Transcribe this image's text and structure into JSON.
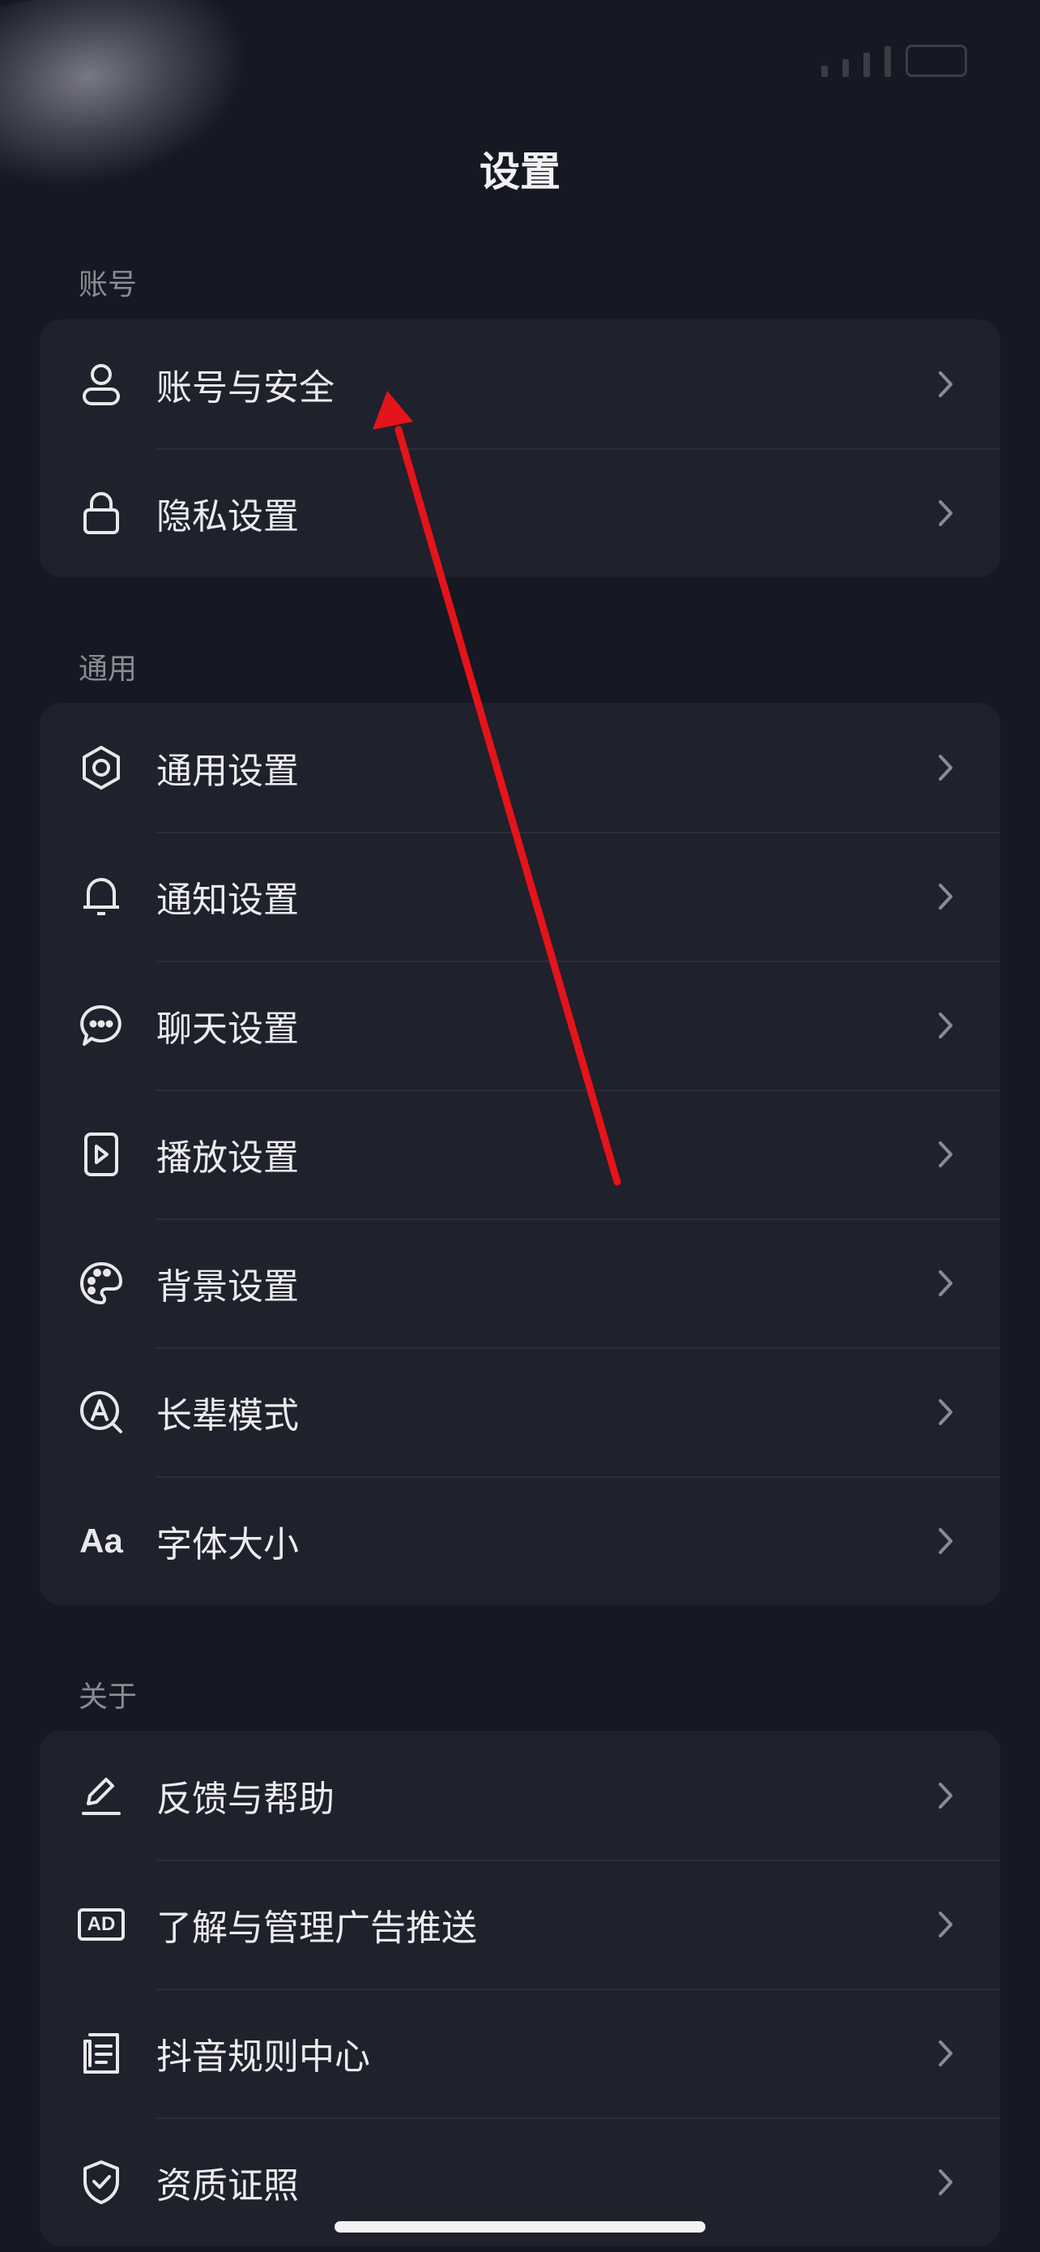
{
  "header": {
    "title": "设置"
  },
  "sections": [
    {
      "label": "账号",
      "items": [
        {
          "label": "账号与安全",
          "icon": "user-icon"
        },
        {
          "label": "隐私设置",
          "icon": "lock-icon"
        }
      ]
    },
    {
      "label": "通用",
      "items": [
        {
          "label": "通用设置",
          "icon": "gear-icon"
        },
        {
          "label": "通知设置",
          "icon": "bell-icon"
        },
        {
          "label": "聊天设置",
          "icon": "chat-icon"
        },
        {
          "label": "播放设置",
          "icon": "play-icon"
        },
        {
          "label": "背景设置",
          "icon": "palette-icon"
        },
        {
          "label": "长辈模式",
          "icon": "elder-mode-icon"
        },
        {
          "label": "字体大小",
          "icon": "font-size-icon",
          "icon_text": "Aa"
        }
      ]
    },
    {
      "label": "关于",
      "items": [
        {
          "label": "反馈与帮助",
          "icon": "edit-icon"
        },
        {
          "label": "了解与管理广告推送",
          "icon": "ad-icon",
          "icon_text": "AD"
        },
        {
          "label": "抖音规则中心",
          "icon": "document-icon"
        },
        {
          "label": "资质证照",
          "icon": "shield-check-icon"
        }
      ]
    }
  ],
  "colors": {
    "background": "#161823",
    "card": "#1f212c",
    "annotation_arrow": "#e5131a"
  }
}
